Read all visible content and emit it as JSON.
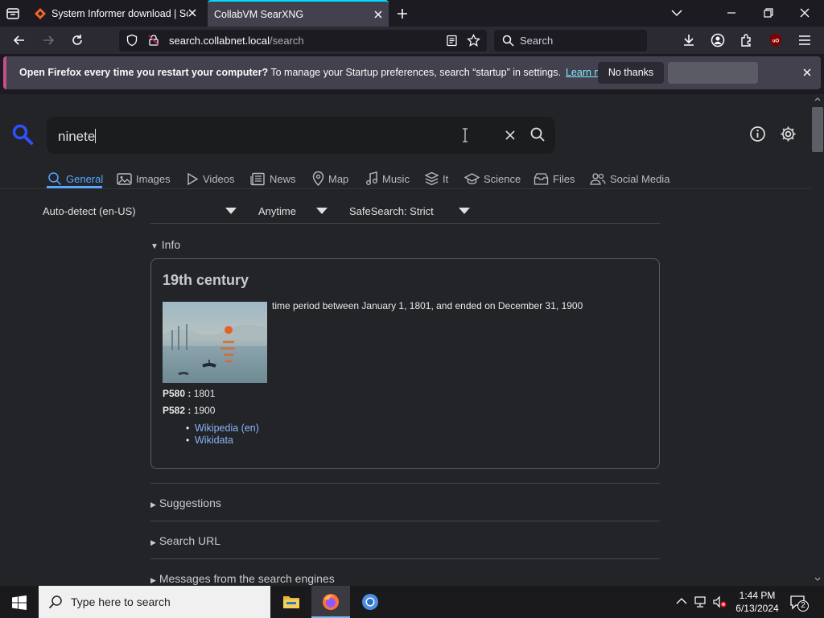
{
  "browser": {
    "tabs": [
      {
        "title": "System Informer download | So",
        "active": false
      },
      {
        "title": "CollabVM SearXNG",
        "active": true
      }
    ],
    "url": {
      "host": "search.collabnet.local",
      "path": "/search"
    },
    "search_placeholder": "Search"
  },
  "notification": {
    "bold": "Open Firefox every time you restart your computer?",
    "text": " To manage your Startup preferences, search “startup” in settings.",
    "learn_more": "Learn more",
    "no_thanks": "No thanks"
  },
  "searx": {
    "query": "ninete",
    "categories": [
      "General",
      "Images",
      "Videos",
      "News",
      "Map",
      "Music",
      "It",
      "Science",
      "Files",
      "Social Media"
    ],
    "active_category": "General",
    "filters": {
      "language": "Auto-detect (en-US)",
      "time": "Anytime",
      "safesearch": "SafeSearch: Strict"
    },
    "info_label": "Info",
    "infobox": {
      "title": "19th century",
      "description": "time period between January 1, 1801, and ended on December 31, 1900",
      "props": [
        {
          "key": "P580 :",
          "value": " 1801"
        },
        {
          "key": "P582 :",
          "value": " 1900"
        }
      ],
      "links": [
        "Wikipedia (en)",
        "Wikidata"
      ]
    },
    "sections": [
      "Suggestions",
      "Search URL",
      "Messages from the search engines"
    ]
  },
  "taskbar": {
    "search_placeholder": "Type here to search",
    "time": "1:44 PM",
    "date": "6/13/2024",
    "notification_count": "2"
  },
  "colors": {
    "accent": "#58a6ff",
    "tab_highlight": "#00ddff",
    "notif_border": "#c4508a"
  }
}
